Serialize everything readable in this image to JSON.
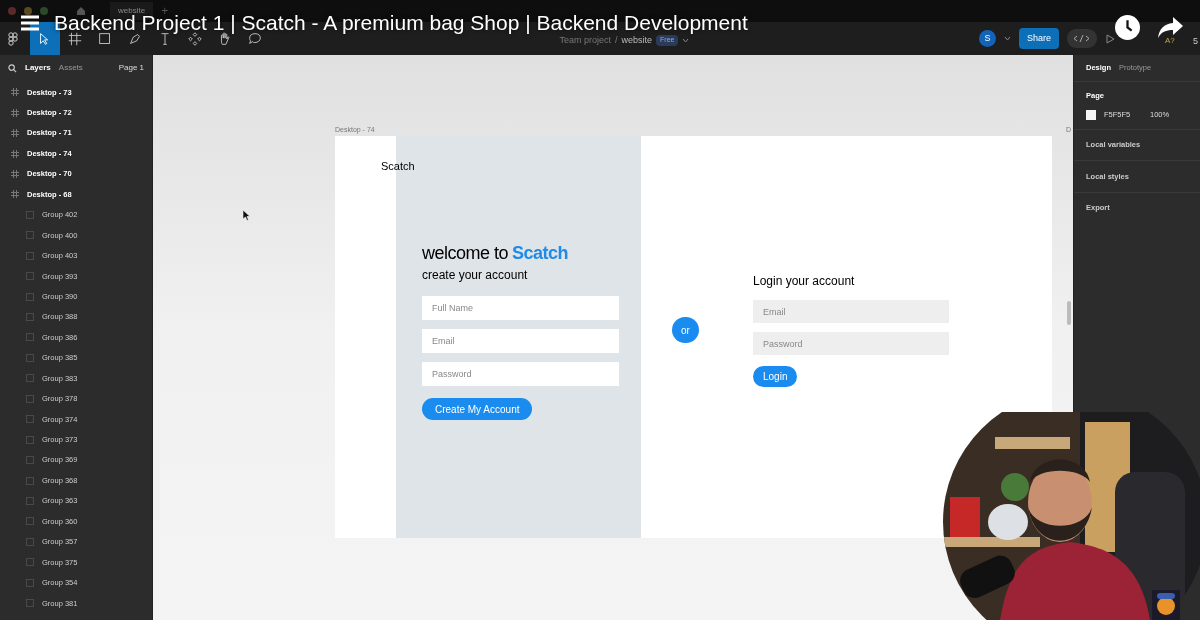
{
  "video": {
    "title": "Backend Project 1 | Scatch - A premium bag Shop | Backend Development",
    "caption_hint": "A?",
    "edge_text": "5"
  },
  "browser_tabs": [
    {
      "label": "website",
      "selected": true
    }
  ],
  "new_tab_label": "+",
  "toolbar": {
    "tools": [
      {
        "kind": "move",
        "selected": true
      },
      {
        "kind": "frame",
        "selected": false
      },
      {
        "kind": "shape",
        "selected": false
      },
      {
        "kind": "pen",
        "selected": false
      },
      {
        "kind": "text",
        "selected": false
      },
      {
        "kind": "components",
        "selected": false
      },
      {
        "kind": "hand",
        "selected": false
      },
      {
        "kind": "comment",
        "selected": false
      }
    ],
    "breadcrumb": {
      "team": "Team project",
      "separator": "/",
      "file": "website",
      "plan": "Free"
    },
    "avatar": "S",
    "share": "Share"
  },
  "left_panel": {
    "tabs": [
      {
        "label": "Layers",
        "selected": true
      },
      {
        "label": "Assets",
        "selected": false
      }
    ],
    "page": "Page 1",
    "layers": [
      {
        "name": "Desktop - 73"
      },
      {
        "name": "Desktop - 72"
      },
      {
        "name": "Desktop - 71"
      },
      {
        "name": "Desktop - 74"
      },
      {
        "name": "Desktop - 70"
      },
      {
        "name": "Desktop - 68",
        "children": [
          {
            "name": "Group 402"
          },
          {
            "name": "Group 400"
          },
          {
            "name": "Group 403"
          },
          {
            "name": "Group 393"
          },
          {
            "name": "Group 390"
          },
          {
            "name": "Group 388"
          },
          {
            "name": "Group 386"
          },
          {
            "name": "Group 385"
          },
          {
            "name": "Group 383"
          },
          {
            "name": "Group 378"
          },
          {
            "name": "Group 374"
          },
          {
            "name": "Group 373"
          },
          {
            "name": "Group 369"
          },
          {
            "name": "Group 368"
          },
          {
            "name": "Group 363"
          },
          {
            "name": "Group 360"
          },
          {
            "name": "Group 357"
          },
          {
            "name": "Group 375"
          },
          {
            "name": "Group 354"
          },
          {
            "name": "Group 381"
          }
        ]
      }
    ]
  },
  "right_panel": {
    "tabs": [
      {
        "label": "Design",
        "selected": true
      },
      {
        "label": "Prototype",
        "selected": false
      }
    ],
    "page_heading": "Page",
    "page_color": "F5F5F5",
    "page_opacity": "100%",
    "sections": [
      "Local variables",
      "Local styles",
      "Export"
    ]
  },
  "canvas": {
    "frame_label": "Desktop - 74",
    "right_frame_label": "D",
    "brand": "Scatch",
    "welcome_prefix": "welcome to",
    "welcome_brand": "Scatch",
    "signup_title": "create your account",
    "signup_fields": [
      {
        "placeholder": "Full Name"
      },
      {
        "placeholder": "Email"
      },
      {
        "placeholder": "Password"
      }
    ],
    "signup_button": "Create My Account",
    "divider": "or",
    "login_title": "Login your account",
    "login_fields": [
      {
        "placeholder": "Email"
      },
      {
        "placeholder": "Password"
      }
    ],
    "login_button": "Login"
  }
}
